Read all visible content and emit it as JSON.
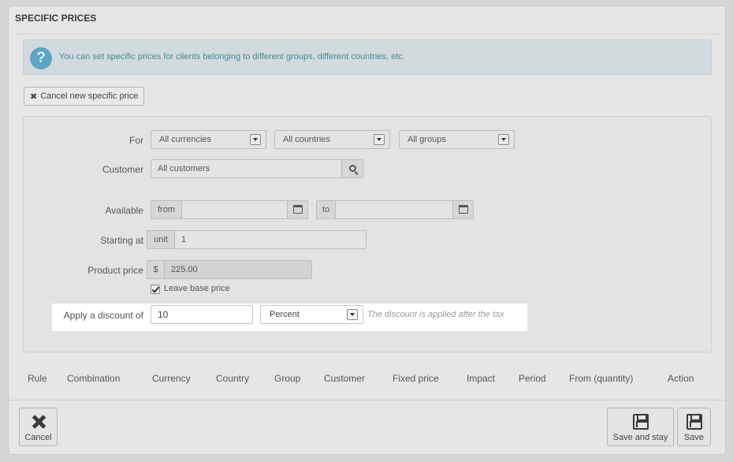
{
  "panel": {
    "title": "SPECIFIC PRICES"
  },
  "alert": {
    "icon": "question-icon",
    "glyph": "?",
    "text": "You can set specific prices for clients belonging to different groups, different countries, etc."
  },
  "cancel_new_button": {
    "icon": "close-icon",
    "glyph": "✖",
    "label": "Cancel new specific price"
  },
  "form": {
    "for_label": "For",
    "currency_select": "All currencies",
    "country_select": "All countries",
    "group_select": "All groups",
    "customer_label": "Customer",
    "customer_value": "All customers",
    "available_label": "Available",
    "from_label": "from",
    "from_value": "",
    "to_label": "to",
    "to_value": "",
    "starting_at_label": "Starting at",
    "unit_label": "unit",
    "starting_at_value": "1",
    "product_price_label": "Product price",
    "currency_symbol": "$",
    "product_price_value": "225.00",
    "leave_base_price_label": "Leave base price",
    "leave_base_price_checked": true,
    "discount_label": "Apply a discount of",
    "discount_value": "10",
    "discount_type": "Percent",
    "discount_hint": "The discount is applied after the tax"
  },
  "table": {
    "headers": [
      "Rule",
      "Combination",
      "Currency",
      "Country",
      "Group",
      "Customer",
      "Fixed price",
      "Impact",
      "Period",
      "From (quantity)",
      "Action"
    ]
  },
  "footer": {
    "cancel_label": "Cancel",
    "save_and_stay_label": "Save and stay",
    "save_label": "Save"
  },
  "colors": {
    "background": "#d6d6d6",
    "alert_text": "#3b8aa8",
    "info_icon": "#5aa6c4",
    "highlight": "#ffffff"
  }
}
